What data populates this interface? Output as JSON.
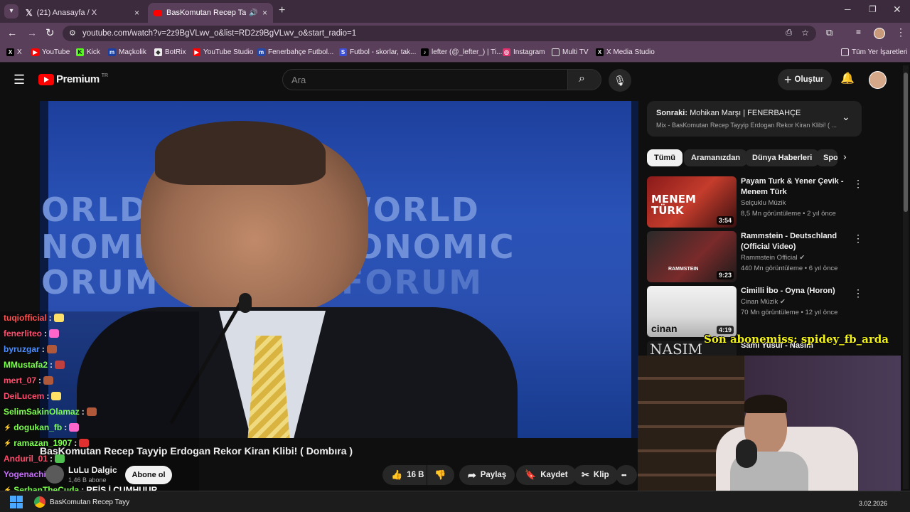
{
  "tabs": [
    {
      "title": "(21) Anasayfa / X",
      "close": "×"
    },
    {
      "title": "BasKomutan Recep Tayyip E",
      "close": "×"
    }
  ],
  "new_tab": "+",
  "url": "youtube.com/watch?v=2z9BgVLwv_o&list=RD2z9BgVLwv_o&start_radio=1",
  "bookmarks": [
    "X",
    "YouTube",
    "Kick",
    "Maçkolik",
    "BotRix",
    "YouTube Studio",
    "Fenerbahçe Futbol...",
    "Futbol - skorlar, tak...",
    "lefter (@_lefter_) | Ti...",
    "Instagram",
    "Multi TV",
    "X Media Studio",
    "Tüm Yer İşaretleri"
  ],
  "yt": {
    "logo": "Premium",
    "logo_sup": "TR",
    "search_placeholder": "Ara",
    "create": "Oluştur"
  },
  "video": {
    "title": "BasKomutan Recep Tayyip Erdogan Rekor Kiran Klibi! ( Dombıra )",
    "channel": "LuLu Dalgic",
    "subs": "1,46 B abone",
    "subscribe": "Abone ol",
    "likes": "16 B",
    "share": "Paylaş",
    "save": "Kaydet",
    "clip": "Klip",
    "more": "•••",
    "wef_lines": [
      "ORLD",
      "WORLD",
      "NOMIC",
      "ECONOMIC",
      "ORUM",
      "FORUM"
    ]
  },
  "upnext": {
    "label": "Sonraki:",
    "title": "Mohikan Marşı | FENERBAHÇE",
    "sub": "Mix - BasKomutan Recep Tayyip Erdogan Rekor Kiran Klibi! ( ..."
  },
  "chips": [
    "Tümü",
    "Aramanızdan",
    "Dünya Haberleri",
    "Spo"
  ],
  "recs": [
    {
      "title": "Payam Turk & Yener Çevik - Menem Türk",
      "channel": "Selçuklu Müzik",
      "meta": "8,5 Mn görüntüleme • 2 yıl önce",
      "duration": "3:54",
      "thumb_text": "MENEM TÜRK"
    },
    {
      "title": "Rammstein - Deutschland (Official Video)",
      "channel": "Rammstein Official",
      "meta": "440 Mn görüntüleme • 6 yıl önce",
      "duration": "9:23",
      "thumb_text": "RAMMSTEIN"
    },
    {
      "title": "Cimilli İbo - Oyna (Horon)",
      "channel": "Cinan Müzik",
      "meta": "70 Mn görüntüleme • 12 yıl önce",
      "duration": "4:19",
      "thumb_text": "cinan"
    }
  ],
  "partial_rec": {
    "title": "Sami Yusuf - Nasim",
    "thumb_text": "NASIM"
  },
  "overlay": {
    "last_sub": "Son abonemiss: spidey_fb_arda",
    "chat": [
      {
        "user": "tuqiofficial",
        "msg": "",
        "color": "#ff5050",
        "emote": "#ffe066"
      },
      {
        "user": "fenerliteo",
        "msg": "",
        "color": "#ff4d6d",
        "emote": "#ff66cc"
      },
      {
        "user": "byruzgar",
        "msg": "",
        "color": "#4d8dff",
        "emote": "#b0583a"
      },
      {
        "user": "MMustafa2",
        "msg": "",
        "color": "#7cff4d",
        "emote": "#c04040"
      },
      {
        "user": "mert_07",
        "msg": "",
        "color": "#ff4d6d",
        "emote": "#b0583a"
      },
      {
        "user": "DeiLucem",
        "msg": "",
        "color": "#ff4d6d",
        "emote": "#ffe066"
      },
      {
        "user": "SelimSakinOlamaz",
        "msg": "",
        "color": "#7cff4d",
        "emote": "#b0583a"
      },
      {
        "user": "dogukan_fb",
        "msg": "",
        "color": "#7cff4d",
        "emote": "#ff66cc"
      },
      {
        "user": "ramazan_1907",
        "msg": "",
        "color": "#7cff4d",
        "emote": "#e03030"
      },
      {
        "user": "Anduril_01",
        "msg": "",
        "color": "#ff4d6d",
        "emote": "#50c050"
      },
      {
        "user": "Yogenachi",
        "msg": "",
        "color": "#c86bff",
        "emote": "#aaa"
      },
      {
        "user": "SerhanTheCuda",
        "msg": "REİS İ CUMHUUR",
        "color": "#7cff4d",
        "emote": ""
      }
    ]
  },
  "taskbar": {
    "window": "BasKomutan Recep Tayy",
    "date": "3.02.2026"
  }
}
